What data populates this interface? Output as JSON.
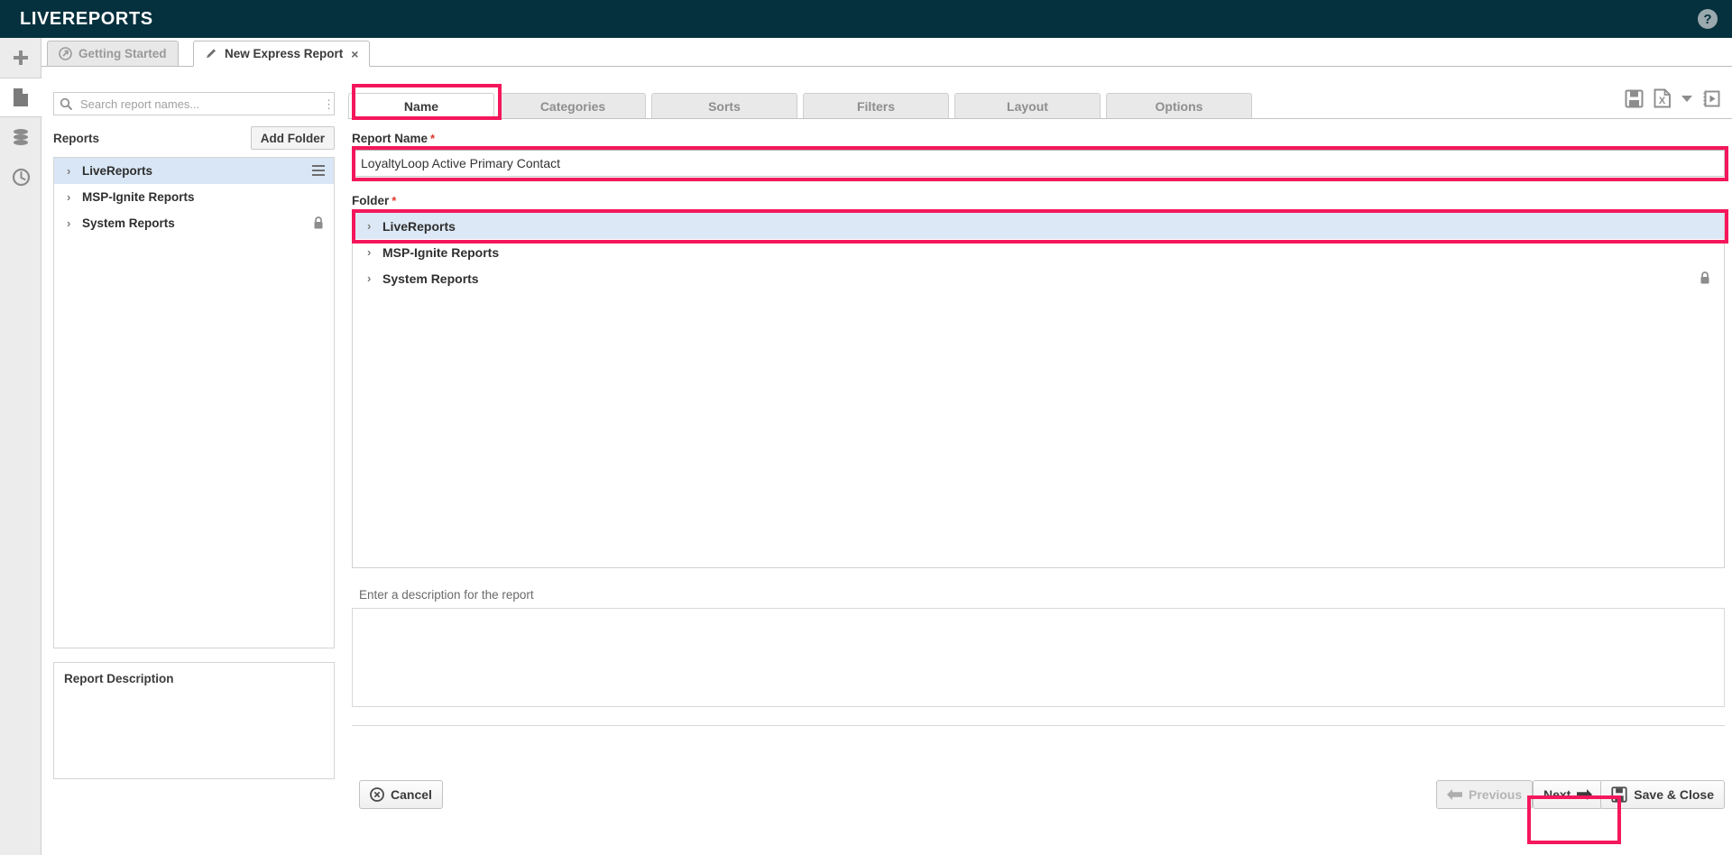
{
  "app": {
    "brand": "LIVEREPORTS",
    "help_icon": "question-mark-icon",
    "accent": "#f4175c",
    "topbar_color": "#05303d"
  },
  "rail": {
    "items": [
      {
        "icon": "plus-icon",
        "name": "add"
      },
      {
        "icon": "document-icon",
        "name": "reports",
        "active": true
      },
      {
        "icon": "database-icon",
        "name": "data"
      },
      {
        "icon": "clock-icon",
        "name": "history"
      }
    ]
  },
  "window_tabs": [
    {
      "label": "Getting Started",
      "icon": "arrow-circle-icon",
      "active": false,
      "closable": false
    },
    {
      "label": "New Express Report",
      "icon": "pencil-icon",
      "active": true,
      "closable": true,
      "close_label": "×"
    }
  ],
  "left_panel": {
    "search": {
      "placeholder": "Search report names...",
      "value": "",
      "icon": "search-icon",
      "menu_icon": "kebab-menu-icon"
    },
    "reports_label": "Reports",
    "add_folder_label": "Add Folder",
    "tree": [
      {
        "label": "LiveReports",
        "selected": true,
        "expanded": false,
        "has_menu": true,
        "locked": false
      },
      {
        "label": "MSP-Ignite Reports",
        "selected": false,
        "expanded": false,
        "has_menu": false,
        "locked": false
      },
      {
        "label": "System Reports",
        "selected": false,
        "expanded": false,
        "has_menu": false,
        "locked": true
      }
    ],
    "description_title": "Report Description",
    "description_value": ""
  },
  "main": {
    "step_tabs": [
      {
        "label": "Name",
        "active": true,
        "highlighted": true
      },
      {
        "label": "Categories",
        "active": false,
        "highlighted": false
      },
      {
        "label": "Sorts",
        "active": false,
        "highlighted": false
      },
      {
        "label": "Filters",
        "active": false,
        "highlighted": false
      },
      {
        "label": "Layout",
        "active": false,
        "highlighted": false
      },
      {
        "label": "Options",
        "active": false,
        "highlighted": false
      }
    ],
    "toolbar_icons": [
      {
        "name": "save-icon",
        "label": "Save"
      },
      {
        "name": "excel-export-icon",
        "label": "Export to Excel"
      },
      {
        "name": "chevron-down-icon",
        "label": "Export options"
      },
      {
        "name": "run-report-icon",
        "label": "Run"
      }
    ],
    "report_name": {
      "label": "Report Name",
      "required_marker": "*",
      "value": "LoyaltyLoop Active Primary Contact",
      "placeholder": ""
    },
    "folder": {
      "label": "Folder",
      "required_marker": "*",
      "tree": [
        {
          "label": "LiveReports",
          "selected": true,
          "locked": false
        },
        {
          "label": "MSP-Ignite Reports",
          "selected": false,
          "locked": false
        },
        {
          "label": "System Reports",
          "selected": false,
          "locked": true
        }
      ]
    },
    "description": {
      "hint": "Enter a description for the report",
      "value": "",
      "placeholder": ""
    },
    "buttons": {
      "cancel": {
        "label": "Cancel",
        "icon": "cancel-circle-icon",
        "enabled": true
      },
      "previous": {
        "label": "Previous",
        "icon": "arrow-left-icon",
        "enabled": false
      },
      "next": {
        "label": "Next",
        "icon": "arrow-right-icon",
        "enabled": true,
        "highlighted": true
      },
      "save_close": {
        "label": "Save & Close",
        "icon": "save-icon",
        "enabled": true
      }
    }
  }
}
